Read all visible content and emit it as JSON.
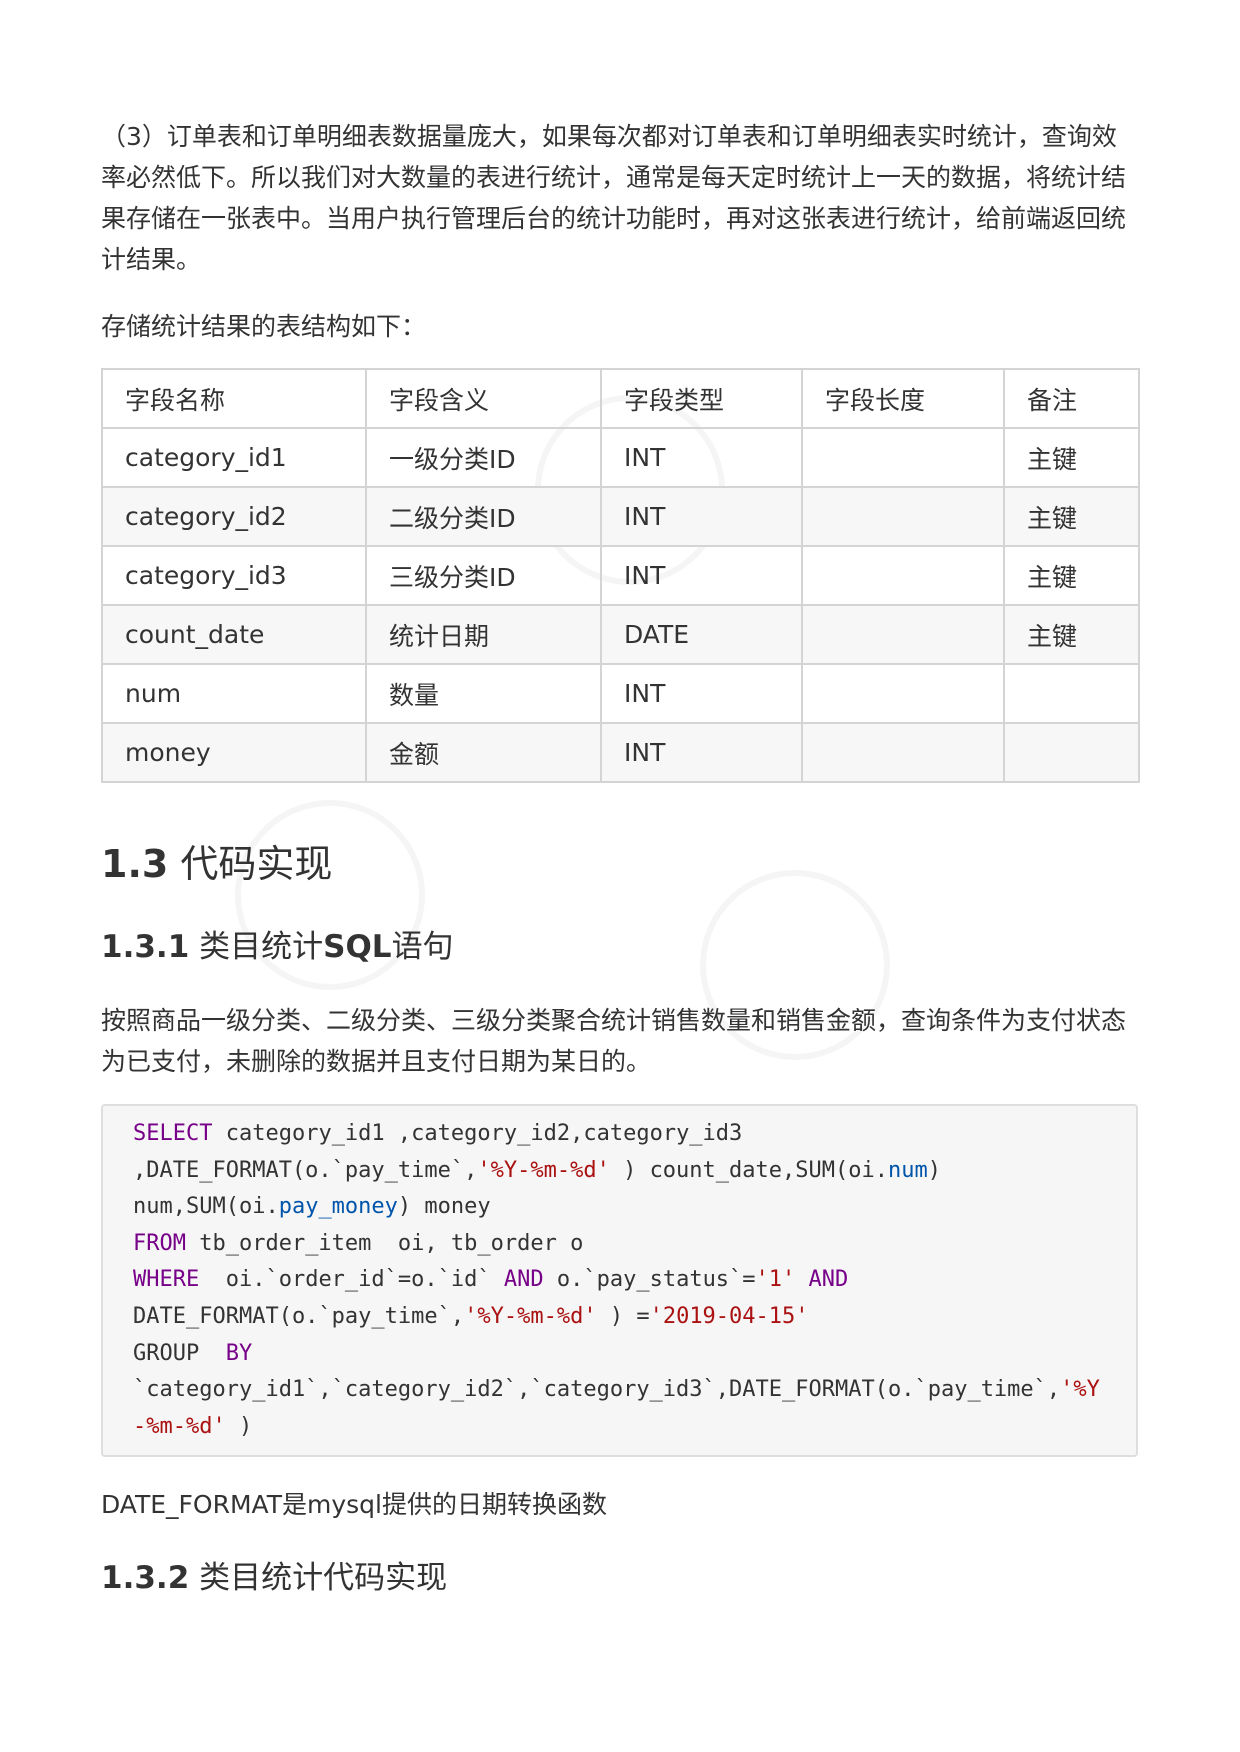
{
  "intro_paragraph": "（3）订单表和订单明细表数据量庞大，如果每次都对订单表和订单明细表实时统计，查询效率必然低下。所以我们对大数量的表进行统计，通常是每天定时统计上一天的数据，将统计结果存储在一张表中。当用户执行管理后台的统计功能时，再对这张表进行统计，给前端返回统计结果。",
  "table_caption": "存储统计结果的表结构如下：",
  "table": {
    "headers": [
      "字段名称",
      "字段含义",
      "字段类型",
      "字段长度",
      "备注"
    ],
    "rows": [
      [
        "category_id1",
        "一级分类ID",
        "INT",
        "",
        "主键"
      ],
      [
        "category_id2",
        "二级分类ID",
        "INT",
        "",
        "主键"
      ],
      [
        "category_id3",
        "三级分类ID",
        "INT",
        "",
        "主键"
      ],
      [
        "count_date",
        "统计日期",
        "DATE",
        "",
        "主键"
      ],
      [
        "num",
        "数量",
        "INT",
        "",
        ""
      ],
      [
        "money",
        "金额",
        "INT",
        "",
        ""
      ]
    ]
  },
  "section_heading": {
    "number": "1.3",
    "text": "代码实现"
  },
  "subsection1": {
    "number": "1.3.1",
    "text_before": "类目统计",
    "text_bold": "SQL",
    "text_after": "语句"
  },
  "description": "按照商品一级分类、二级分类、三级分类聚合统计销售数量和销售金额，查询条件为支付状态为已支付，未删除的数据并且支付日期为某日的。",
  "code": {
    "line1": {
      "kw": "SELECT",
      "rest": " category_id1 ,category_id2,category_id3"
    },
    "line2": {
      "a": ",DATE_FORMAT(o.`pay_time`,",
      "s": "'%Y-%m-%d'",
      "b": " ) count_date,SUM(oi.",
      "p": "num",
      "c": ")"
    },
    "line3": {
      "a": "num,SUM(oi.",
      "p": "pay_money",
      "b": ") money"
    },
    "line4": {
      "kw": "FROM",
      "rest": " tb_order_item  oi, tb_order o"
    },
    "line5": {
      "kw": "WHERE",
      "a": "  oi.`order_id`=o.`id` ",
      "kw2": "AND",
      "b": " o.`pay_status`=",
      "s": "'1'",
      "c": " ",
      "kw3": "AND"
    },
    "line6": {
      "a": "DATE_FORMAT(o.`pay_time`,",
      "s": "'%Y-%m-%d'",
      "b": " ) =",
      "s2": "'2019-04-15'"
    },
    "line7": {
      "a": "GROUP  ",
      "kw": "BY"
    },
    "line8": {
      "a": "`category_id1`,`category_id2`,`category_id3`,DATE_FORMAT(o.`pay_time`,",
      "s": "'%Y"
    },
    "line9": {
      "s": "-%m-%d'",
      "a": " )"
    }
  },
  "note": "DATE_FORMAT是mysql提供的日期转换函数",
  "subsection2": {
    "number": "1.3.2",
    "text": "类目统计代码实现"
  },
  "colors": {
    "keyword": "#770088",
    "string": "#aa1111",
    "property": "#0055aa"
  }
}
